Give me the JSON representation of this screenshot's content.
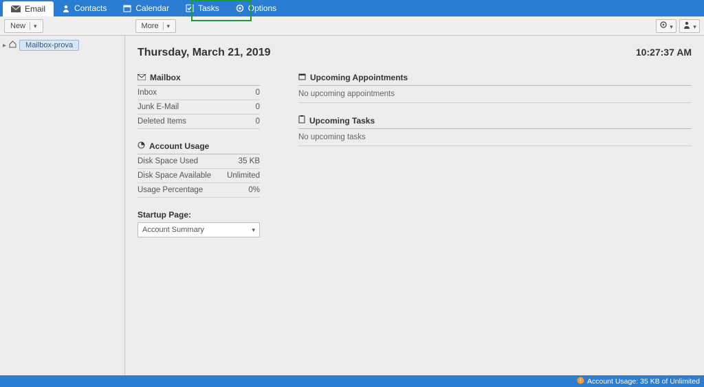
{
  "topnav": {
    "email": "Email",
    "contacts": "Contacts",
    "calendar": "Calendar",
    "tasks": "Tasks",
    "options": "Options"
  },
  "toolbar": {
    "new_label": "New",
    "more_label": "More"
  },
  "sidebar": {
    "mailbox_name": "Mailbox-prova"
  },
  "header": {
    "date": "Thursday, March 21, 2019",
    "time": "10:27:37 AM"
  },
  "mailbox_section": {
    "title": "Mailbox",
    "rows": [
      {
        "label": "Inbox",
        "value": "0"
      },
      {
        "label": "Junk E-Mail",
        "value": "0"
      },
      {
        "label": "Deleted Items",
        "value": "0"
      }
    ]
  },
  "usage_section": {
    "title": "Account Usage",
    "rows": [
      {
        "label": "Disk Space Used",
        "value": "35 KB"
      },
      {
        "label": "Disk Space Available",
        "value": "Unlimited"
      },
      {
        "label": "Usage Percentage",
        "value": "0%"
      }
    ]
  },
  "startup": {
    "label": "Startup Page:",
    "selected": "Account Summary"
  },
  "appointments": {
    "title": "Upcoming Appointments",
    "empty": "No upcoming appointments"
  },
  "tasks_section": {
    "title": "Upcoming Tasks",
    "empty": "No upcoming tasks"
  },
  "footer": {
    "usage_text": "Account Usage: 35 KB of Unlimited"
  }
}
